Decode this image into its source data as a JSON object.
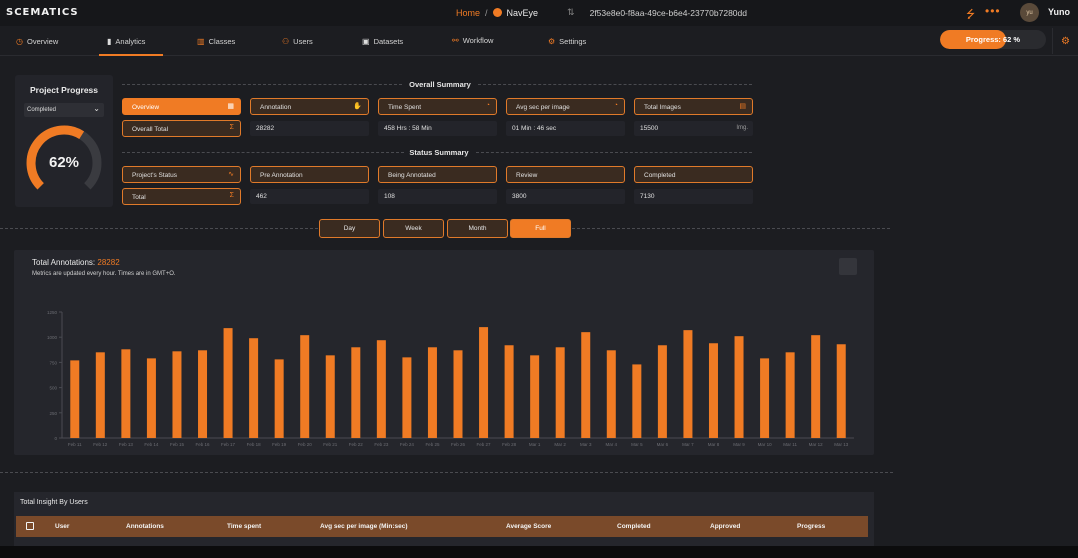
{
  "topbar": {
    "logo": "SCEMATICS",
    "breadcrumb_home": "Home",
    "breadcrumb_sep": "/",
    "project_name": "NavEye",
    "swap_icon": "⇅",
    "project_hash": "2f53e8e0-f8aa-49ce-b6e4-23770b7280dd",
    "avatar_initials": "yu",
    "user_name": "Yuno"
  },
  "tabs": [
    {
      "label": "Overview",
      "icon": "clock-icon"
    },
    {
      "label": "Analytics",
      "icon": "bar-chart-icon"
    },
    {
      "label": "Classes",
      "icon": "classes-icon"
    },
    {
      "label": "Users",
      "icon": "users-icon"
    },
    {
      "label": "Datasets",
      "icon": "image-icon"
    },
    {
      "label": "Workflow",
      "icon": "workflow-icon"
    },
    {
      "label": "Settings",
      "icon": "gear-icon"
    }
  ],
  "progress": {
    "label": "Progress: 62 %",
    "fraction": 0.62
  },
  "project_progress": {
    "title": "Project Progress",
    "select_value": "Completed",
    "percent_label": "62%",
    "fraction": 0.62
  },
  "overall_summary": {
    "title": "Overall Summary",
    "chips": [
      "Overview",
      "Annotation",
      "Time Spent",
      "Avg sec per image",
      "Total Images"
    ],
    "row_label": "Overall Total",
    "values": [
      "28282",
      "458 Hrs : 58 Min",
      "01 Min : 46 sec",
      "15500"
    ],
    "unit_images": "Img."
  },
  "status_summary": {
    "title": "Status Summary",
    "chips": [
      "Project's Status",
      "Pre Annotation",
      "Being Annotated",
      "Review",
      "Completed"
    ],
    "row_label": "Total",
    "values": [
      "462",
      "108",
      "3800",
      "7130"
    ]
  },
  "periods": [
    "Day",
    "Week",
    "Month",
    "Full"
  ],
  "active_period": "Full",
  "chart_header": {
    "title": "Total Annotations: ",
    "total": "28282",
    "subtitle": "Metrics are updated every hour. Times are in GMT+O."
  },
  "chart_data": {
    "type": "bar",
    "title": "Total Annotations: 28282",
    "categories": [
      "Feb 11",
      "Feb 12",
      "Feb 13",
      "Feb 14",
      "Feb 15",
      "Feb 16",
      "Feb 17",
      "Feb 18",
      "Feb 19",
      "Feb 20",
      "Feb 21",
      "Feb 22",
      "Feb 23",
      "Feb 24",
      "Feb 25",
      "Feb 26",
      "Feb 27",
      "Feb 28",
      "Mar 1",
      "Mar 2",
      "Mar 3",
      "Mar 4",
      "Mar 5",
      "Mar 6",
      "Mar 7",
      "Mar 8",
      "Mar 9",
      "Mar 10",
      "Mar 11",
      "Mar 12",
      "Mar 13"
    ],
    "values": [
      770,
      850,
      880,
      790,
      860,
      870,
      1090,
      990,
      780,
      1020,
      820,
      900,
      970,
      800,
      900,
      870,
      1100,
      920,
      820,
      900,
      1050,
      870,
      730,
      920,
      1070,
      940,
      1010,
      790,
      850,
      1020,
      930
    ],
    "yticks": [
      0,
      250,
      500,
      750,
      1000,
      1250
    ],
    "ylim": [
      0,
      1250
    ],
    "color": "#f07b24"
  },
  "insight_table": {
    "title": "Total Insight By Users",
    "columns": [
      "User",
      "Annotations",
      "Time spent",
      "Avg sec per image (Min:sec)",
      "Average Score",
      "Completed",
      "Approved",
      "Progress"
    ]
  }
}
